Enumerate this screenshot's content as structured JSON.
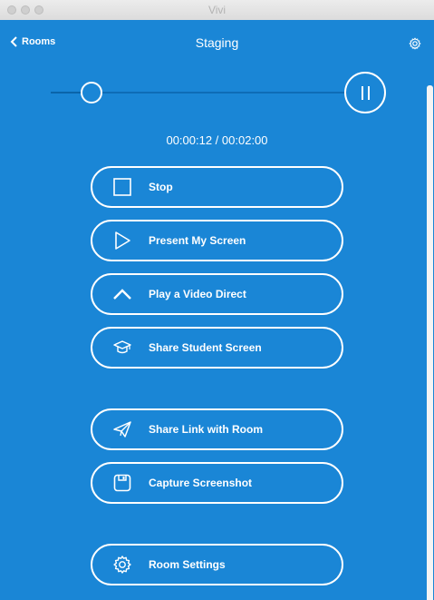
{
  "window": {
    "title": "Vivi"
  },
  "header": {
    "back_label": "Rooms",
    "title": "Staging"
  },
  "player": {
    "elapsed": "00:00:12",
    "total": "00:02:00",
    "time_display": "00:00:12 / 00:02:00",
    "progress": 0.1
  },
  "actions": [
    {
      "label": "Stop",
      "icon": "stop-icon"
    },
    {
      "label": "Present My Screen",
      "icon": "play-triangle-icon"
    },
    {
      "label": "Play a Video Direct",
      "icon": "chevron-up-icon"
    },
    {
      "label": "Share Student Screen",
      "icon": "graduation-cap-icon"
    },
    {
      "label": "Share Link with Room",
      "icon": "paper-plane-icon"
    },
    {
      "label": "Capture Screenshot",
      "icon": "floppy-disk-icon"
    },
    {
      "label": "Room Settings",
      "icon": "gear-icon"
    }
  ],
  "colors": {
    "background": "#1a86d6",
    "foreground": "#ffffff"
  }
}
